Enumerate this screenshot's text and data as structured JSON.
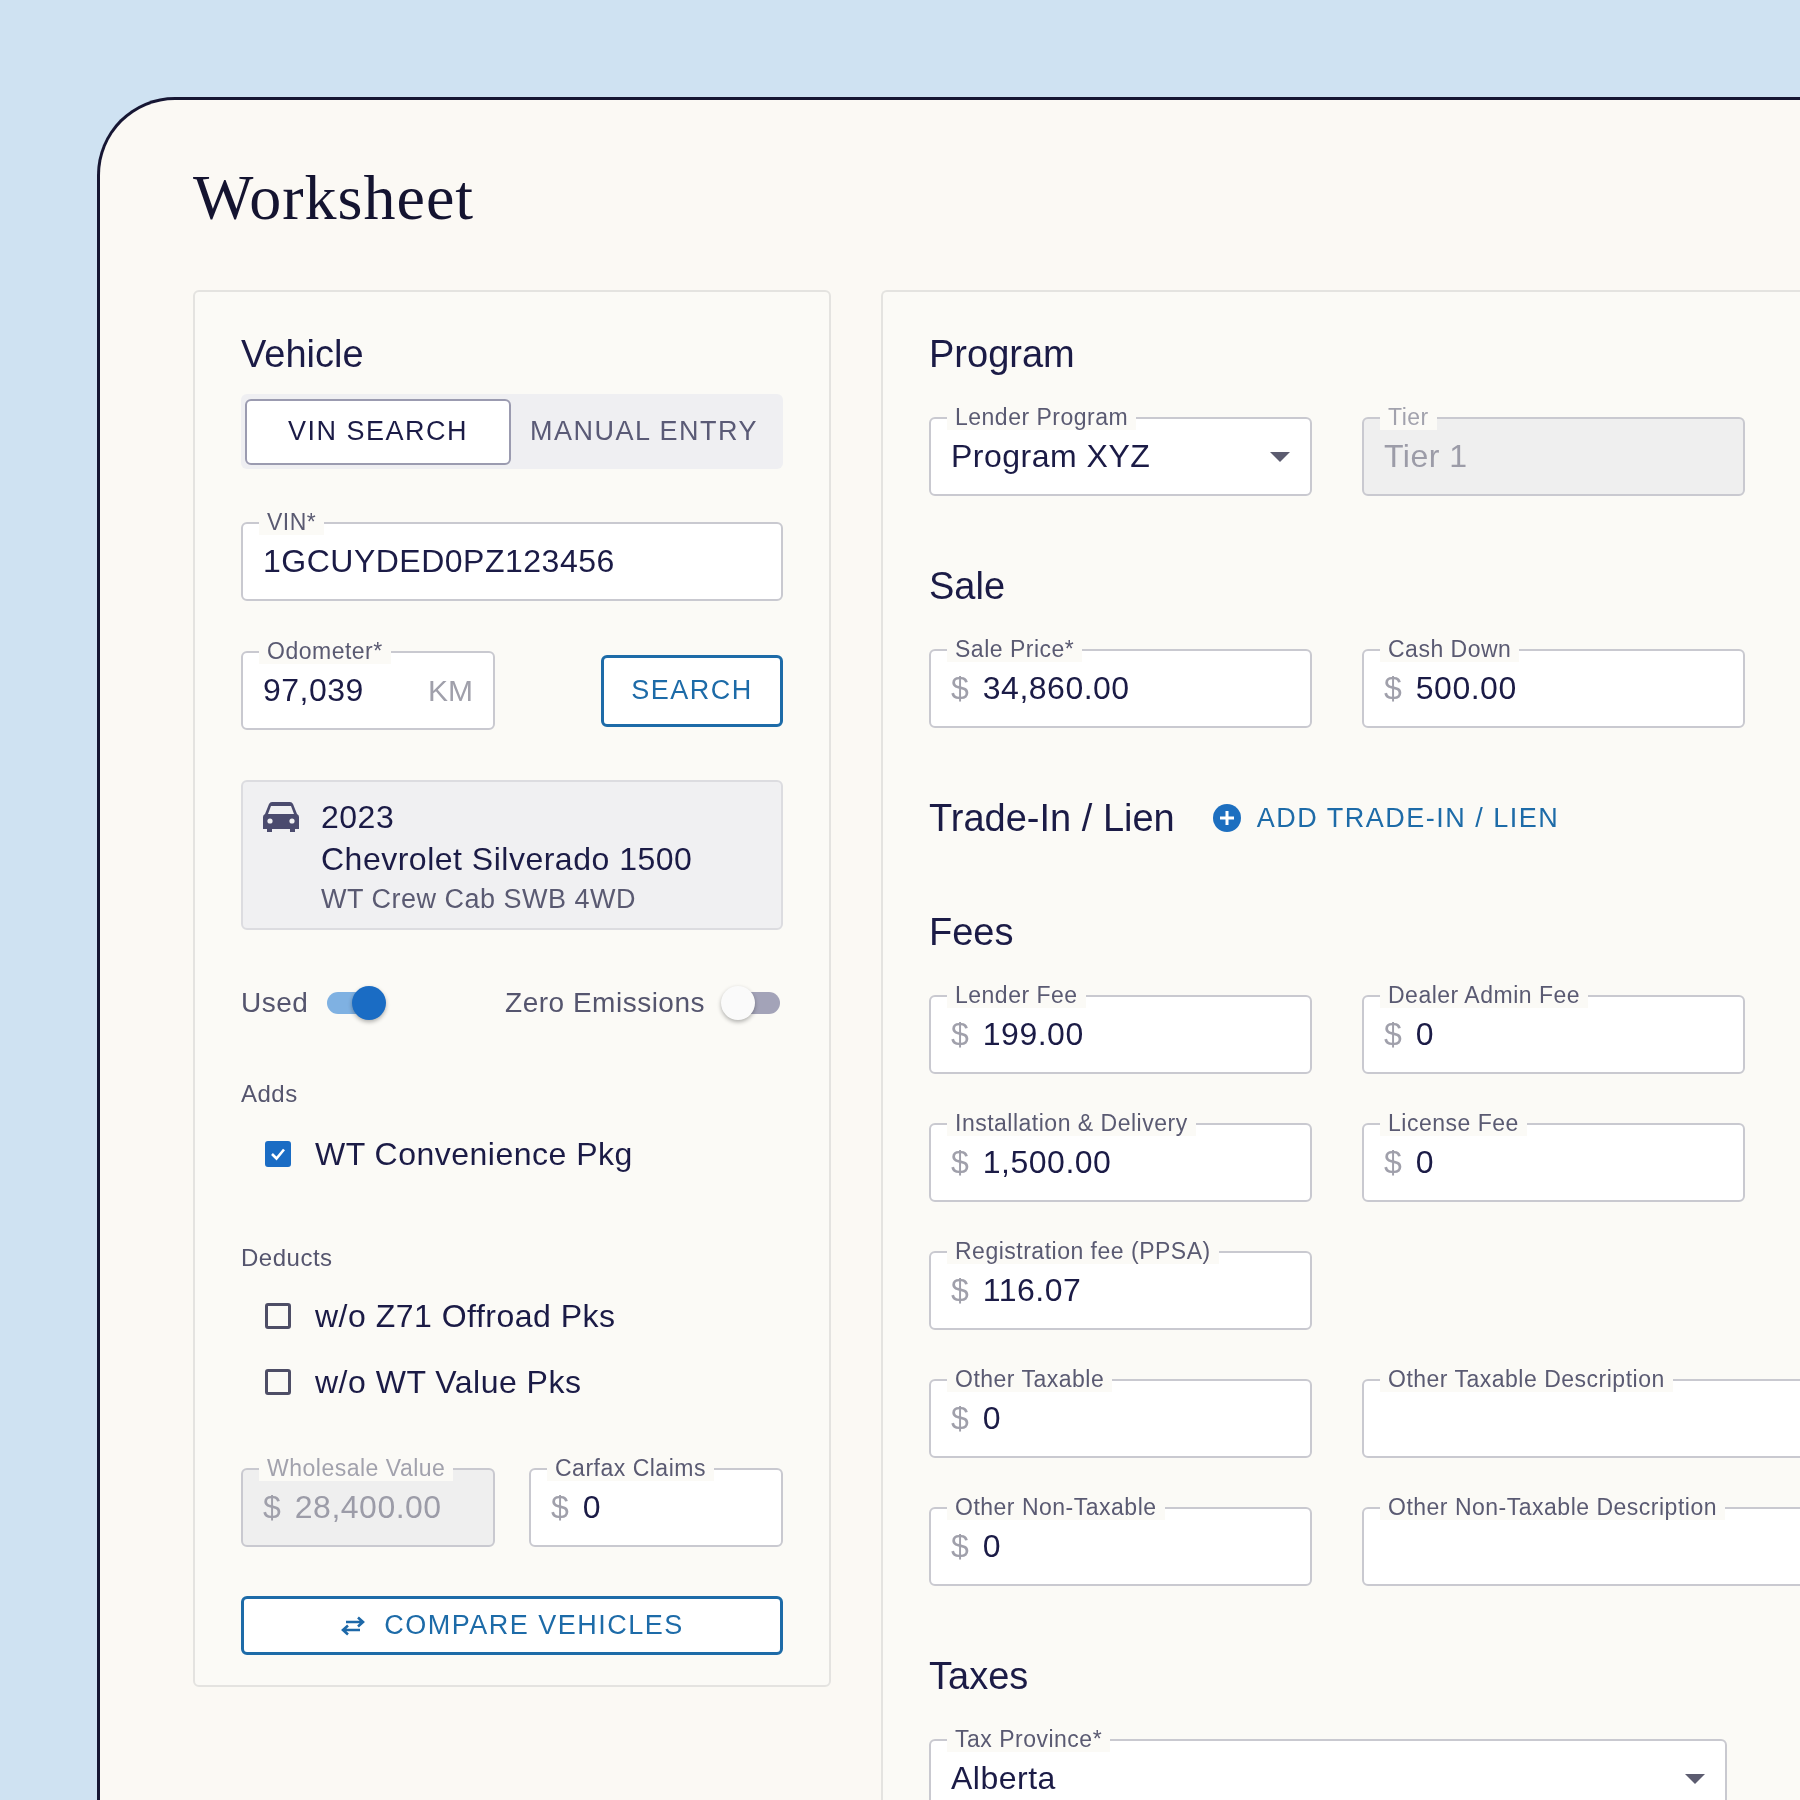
{
  "title": "Worksheet",
  "vehicle": {
    "heading": "Vehicle",
    "modes": [
      {
        "label": "VIN SEARCH",
        "selected": true
      },
      {
        "label": "MANUAL ENTRY",
        "selected": false
      }
    ],
    "vin": {
      "label": "VIN*",
      "value": "1GCUYDED0PZ123456",
      "disabled": false
    },
    "odometer": {
      "label": "Odometer*",
      "value": "97,039",
      "suffix": "KM",
      "disabled": false
    },
    "search_button": "SEARCH",
    "vehicle_card": {
      "year": "2023",
      "model": "Chevrolet Silverado 1500",
      "trim": "WT Crew Cab SWB 4WD"
    },
    "toggles": [
      {
        "label": "Used",
        "on": true
      },
      {
        "label": "Zero Emissions",
        "on": false
      }
    ],
    "adds": {
      "label": "Adds",
      "items": [
        {
          "label": "WT Convenience Pkg",
          "checked": true
        }
      ]
    },
    "deducts": {
      "label": "Deducts",
      "items": [
        {
          "label": "w/o Z71 Offroad Pks",
          "checked": false
        },
        {
          "label": "w/o WT Value Pks",
          "checked": false
        }
      ]
    },
    "values": [
      {
        "label": "Wholesale Value",
        "prefix": "$",
        "value": "28,400.00",
        "disabled": true
      },
      {
        "label": "Carfax Claims",
        "prefix": "$",
        "value": "0",
        "disabled": false
      }
    ],
    "compare_button": "COMPARE VEHICLES"
  },
  "sections": [
    {
      "heading": "Program",
      "rows": [
        [
          {
            "label": "Lender Program",
            "value": "Program XYZ",
            "kind": "select",
            "disabled": false
          },
          {
            "label": "Tier",
            "value": "Tier 1",
            "kind": "text",
            "disabled": true
          }
        ]
      ]
    },
    {
      "heading": "Sale",
      "rows": [
        [
          {
            "label": "Sale Price*",
            "prefix": "$",
            "value": "34,860.00",
            "kind": "text",
            "disabled": false
          },
          {
            "label": "Cash Down",
            "prefix": "$",
            "value": "500.00",
            "kind": "text",
            "disabled": false
          }
        ]
      ]
    },
    {
      "heading": "Trade-In / Lien",
      "action": "ADD TRADE-IN / LIEN"
    },
    {
      "heading": "Fees",
      "rows": [
        [
          {
            "label": "Lender Fee",
            "prefix": "$",
            "value": "199.00",
            "kind": "text",
            "disabled": false
          },
          {
            "label": "Dealer Admin Fee",
            "prefix": "$",
            "value": "0",
            "kind": "text",
            "disabled": false
          }
        ],
        [
          {
            "label": "Installation & Delivery",
            "prefix": "$",
            "value": "1,500.00",
            "kind": "text",
            "disabled": false
          },
          {
            "label": "License Fee",
            "prefix": "$",
            "value": "0",
            "kind": "text",
            "disabled": false
          }
        ],
        [
          {
            "label": "Registration fee (PPSA)",
            "prefix": "$",
            "value": "116.07",
            "kind": "text",
            "disabled": false
          }
        ],
        [
          {
            "label": "Other Taxable",
            "prefix": "$",
            "value": "0",
            "kind": "text",
            "disabled": false
          },
          {
            "label": "Other Taxable Description",
            "kind": "description",
            "disabled": false
          }
        ],
        [
          {
            "label": "Other Non-Taxable",
            "prefix": "$",
            "value": "0",
            "kind": "text",
            "disabled": false
          },
          {
            "label": "Other Non-Taxable Description",
            "kind": "description",
            "disabled": false
          }
        ]
      ]
    },
    {
      "heading": "Taxes",
      "rows": [
        [
          {
            "label": "Tax Province*",
            "value": "Alberta",
            "kind": "wide-select",
            "disabled": false
          }
        ]
      ]
    }
  ]
}
